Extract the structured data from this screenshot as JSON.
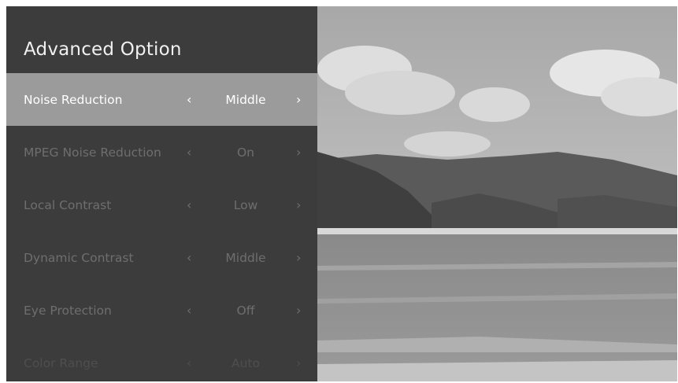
{
  "panel": {
    "title": "Advanced Option",
    "items": [
      {
        "label": "Noise Reduction",
        "value": "Middle",
        "selected": true
      },
      {
        "label": "MPEG Noise Reduction",
        "value": "On",
        "selected": false
      },
      {
        "label": "Local Contrast",
        "value": "Low",
        "selected": false
      },
      {
        "label": "Dynamic Contrast",
        "value": "Middle",
        "selected": false
      },
      {
        "label": "Eye Protection",
        "value": "Off",
        "selected": false
      },
      {
        "label": "Color Range",
        "value": "Auto",
        "selected": false
      }
    ],
    "arrow_left": "‹",
    "arrow_right": "›"
  },
  "colors": {
    "panel_bg": "#3c3c3c",
    "selected_bg": "#9b9b9b",
    "text_active": "#ffffff",
    "text_inactive": "#6e6e6e"
  }
}
